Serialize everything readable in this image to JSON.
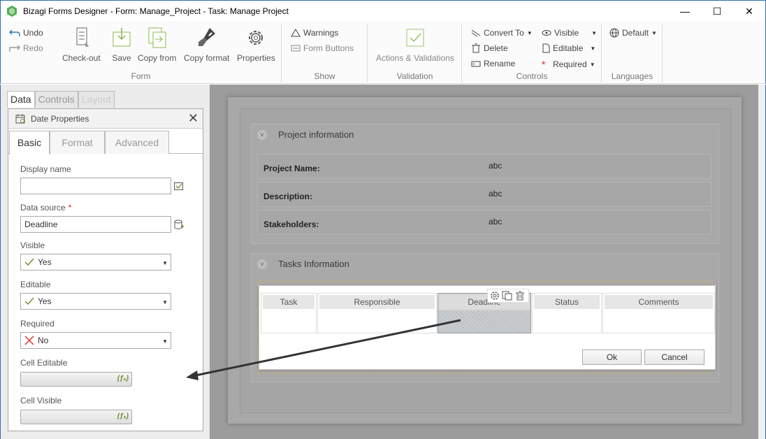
{
  "window": {
    "title": "Bizagi Forms Designer  - Form: Manage_Project - Task:  Manage Project",
    "minimize": "—",
    "maximize": "☐",
    "close": "✕"
  },
  "ribbon": {
    "undo": "Undo",
    "redo": "Redo",
    "checkout": "Check-out",
    "save": "Save",
    "copy_from": "Copy from",
    "copy_format": "Copy format",
    "properties": "Properties",
    "group_form": "Form",
    "warnings": "Warnings",
    "form_buttons": "Form Buttons",
    "group_show": "Show",
    "actions_validations": "Actions & Validations",
    "group_validation": "Validation",
    "convert_to": "Convert To",
    "delete": "Delete",
    "rename": "Rename",
    "visible": "Visible",
    "editable": "Editable",
    "required": "Required",
    "group_controls": "Controls",
    "default": "Default",
    "group_languages": "Languages"
  },
  "left_tabs": [
    "Data",
    "Controls",
    "Layout"
  ],
  "properties_panel": {
    "title": "Date Properties",
    "tabs": [
      "Basic",
      "Format",
      "Advanced"
    ],
    "display_name_label": "Display name",
    "display_name_value": "",
    "data_source_label": "Data source",
    "data_source_value": "Deadline",
    "visible_label": "Visible",
    "visible_value": "Yes",
    "editable_label": "Editable",
    "editable_value": "Yes",
    "required_label": "Required",
    "required_value": "No",
    "cell_editable_label": "Cell Editable",
    "cell_visible_label": "Cell Visible",
    "fx": "(ƒₓ)"
  },
  "form": {
    "group1_title": "Project information",
    "rows": [
      {
        "label": "Project Name:",
        "value": "abc"
      },
      {
        "label": "Description:",
        "value": "abc"
      },
      {
        "label": "Stakeholders:",
        "value": "abc"
      }
    ],
    "group2_title": "Tasks Information",
    "columns": [
      "Task",
      "Responsible",
      "Deadline",
      "Status",
      "Comments"
    ],
    "ok": "Ok",
    "cancel": "Cancel"
  }
}
